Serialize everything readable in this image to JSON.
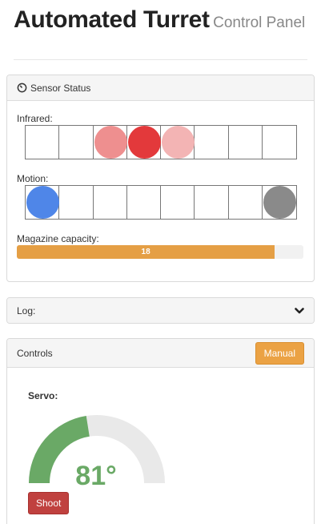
{
  "header": {
    "title": "Automated Turret",
    "subtitle": "Control Panel"
  },
  "sensor_panel": {
    "title": "Sensor Status",
    "icon": "dashboard-icon",
    "infrared_label": "Infrared:",
    "infrared_cells": [
      "",
      "",
      "#ee8f8f",
      "#e3393b",
      "#f3b4b4",
      "",
      "",
      ""
    ],
    "motion_label": "Motion:",
    "motion_cells": [
      "#4f86e8",
      "",
      "",
      "",
      "",
      "",
      "",
      "#8a8a8a"
    ],
    "magazine_label": "Magazine capacity:",
    "magazine_value": "18",
    "magazine_fraction": 0.9,
    "magazine_color": "#e59f45"
  },
  "log_panel": {
    "title": "Log:",
    "icon": "chevron-down-icon"
  },
  "controls_panel": {
    "title": "Controls",
    "manual_label": "Manual",
    "servo_label": "Servo:",
    "servo_value": "81°",
    "servo_fraction": 0.45,
    "gauge_color": "#6aa966",
    "gauge_track_color": "#e9e9e9",
    "shoot_label": "Shoot"
  }
}
